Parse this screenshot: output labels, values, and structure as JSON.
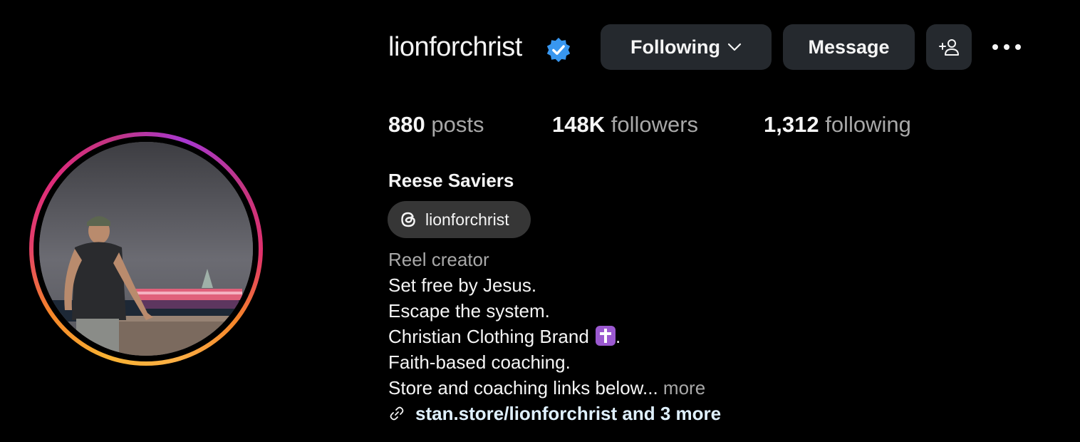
{
  "profile": {
    "username": "lionforchrist",
    "verified_icon": "verified-badge-icon",
    "full_name": "Reese Saviers",
    "threads_handle": "lionforchrist",
    "category": "Reel creator",
    "bio_lines": [
      "Set free by Jesus.",
      "Escape the system.",
      "Christian Clothing Brand",
      "Faith-based coaching.",
      "Store and coaching links below..."
    ],
    "bio_line_3_suffix": ".",
    "bio_more": "more",
    "link_text": "stan.store/lionforchrist and 3 more"
  },
  "actions": {
    "following_label": "Following",
    "message_label": "Message"
  },
  "stats": {
    "posts_count": "880",
    "posts_label": "posts",
    "followers_count": "148K",
    "followers_label": "followers",
    "following_count": "1,312",
    "following_label": "following"
  },
  "icons": {
    "verified": "verified-badge-icon",
    "dropdown": "chevron-down-icon",
    "suggest": "add-person-icon",
    "options": "more-options-icon",
    "threads": "threads-icon",
    "link": "link-icon",
    "cross_emoji": "latin-cross-emoji"
  },
  "colors": {
    "background": "#000000",
    "button_bg": "#25292e",
    "verified_blue": "#3897f0",
    "secondary_text": "#a8a8a8",
    "link_text": "#e0f1ff",
    "story_ring": [
      "#f9b233",
      "#f58529",
      "#dd2a7b",
      "#c13584",
      "#a737d0"
    ]
  }
}
